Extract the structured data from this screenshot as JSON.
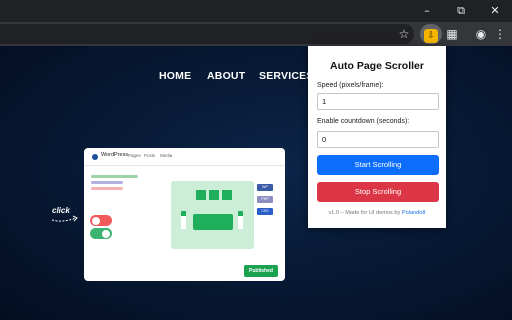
{
  "nav": {
    "items": [
      {
        "label": "HOME"
      },
      {
        "label": "ABOUT"
      },
      {
        "label": "SERVICES"
      }
    ]
  },
  "card": {
    "brand": "WordPress",
    "tabs": [
      "Pages",
      "Posts",
      "Media"
    ],
    "tags": [
      {
        "label": "WP",
        "color": "#3b5ba8"
      },
      {
        "label": "PHP",
        "color": "#8a8fbf"
      },
      {
        "label": "CSS",
        "color": "#2a5fc9"
      }
    ],
    "publish_label": "Published",
    "toggles": [
      {
        "state": "off",
        "color": "#f05a5a"
      },
      {
        "state": "on",
        "color": "#3cb371"
      }
    ]
  },
  "annotation": {
    "click_label": "click"
  },
  "popup": {
    "title": "Auto Page Scroller",
    "speed_label": "Speed (pixels/frame):",
    "speed_value": "1",
    "countdown_label": "Enable countdown (seconds):",
    "countdown_value": "0",
    "start_label": "Start Scrolling",
    "stop_label": "Stop Scrolling",
    "footer_text": "v1.0 – Made for UI demos by ",
    "footer_link": "Polando8",
    "start_color": "#0d6efd",
    "stop_color": "#dc3545"
  },
  "icons": {
    "minimize": "minimize-icon",
    "maximize": "maximize-icon",
    "close": "close-icon",
    "bookmark": "star-icon",
    "extension": "auto-scroll-extension-icon",
    "puzzle": "extensions-puzzle-icon",
    "profile": "profile-icon",
    "menu": "kebab-menu-icon"
  }
}
